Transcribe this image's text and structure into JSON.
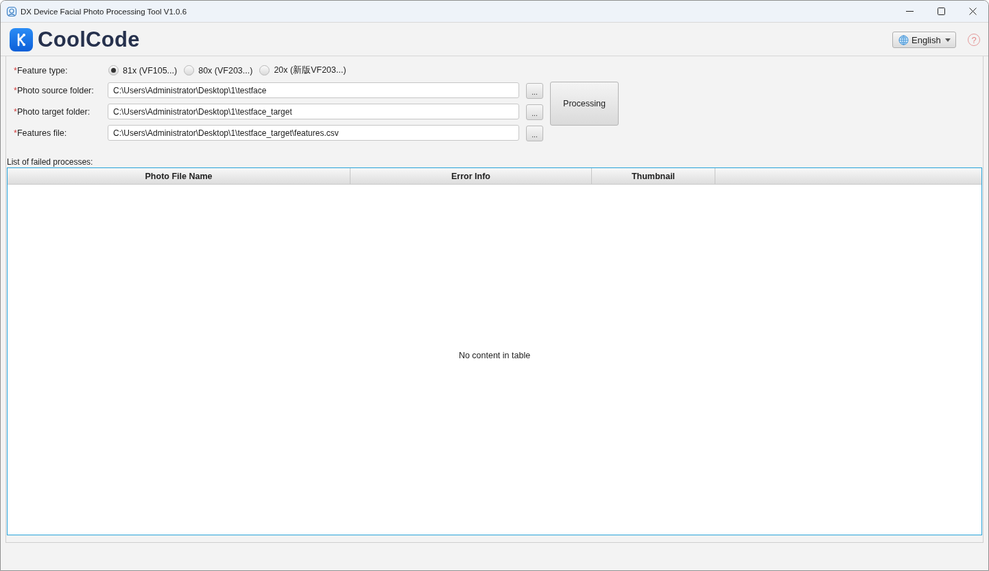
{
  "window": {
    "title": "DX Device Facial Photo Processing Tool V1.0.6"
  },
  "header": {
    "logo_text": "CoolCode",
    "language": "English",
    "help": "?"
  },
  "form": {
    "feature_type": {
      "mark": "*",
      "label": "Feature type:",
      "options": [
        {
          "label": "81x (VF105...)",
          "selected": true
        },
        {
          "label": "80x (VF203...)",
          "selected": false
        },
        {
          "label": "20x (新版VF203...)",
          "selected": false
        }
      ]
    },
    "fields": [
      {
        "mark": "*",
        "label": "Photo source folder:",
        "value": "C:\\Users\\Administrator\\Desktop\\1\\testface",
        "browse": "..."
      },
      {
        "mark": "*",
        "label": "Photo target folder:",
        "value": "C:\\Users\\Administrator\\Desktop\\1\\testface_target",
        "browse": "..."
      },
      {
        "mark": "*",
        "label": "Features file:",
        "value": "C:\\Users\\Administrator\\Desktop\\1\\testface_target\\features.csv",
        "browse": "..."
      }
    ],
    "process_button": "Processing"
  },
  "failed_list": {
    "title": "List of failed processes:",
    "columns": [
      "Photo File Name",
      "Error Info",
      "Thumbnail"
    ],
    "empty_text": "No content in table"
  }
}
